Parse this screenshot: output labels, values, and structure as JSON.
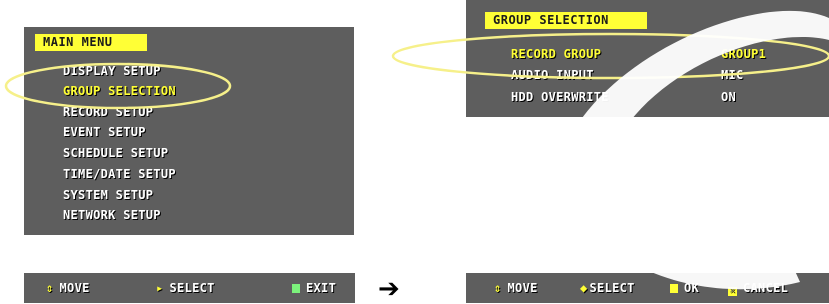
{
  "main_menu": {
    "title": "MAIN MENU",
    "items": [
      {
        "label": "DISPLAY SETUP",
        "selected": false
      },
      {
        "label": "GROUP SELECTION",
        "selected": true
      },
      {
        "label": "RECORD SETUP",
        "selected": false
      },
      {
        "label": "EVENT SETUP",
        "selected": false
      },
      {
        "label": "SCHEDULE SETUP",
        "selected": false
      },
      {
        "label": "TIME/DATE SETUP",
        "selected": false
      },
      {
        "label": "SYSTEM SETUP",
        "selected": false
      },
      {
        "label": "NETWORK SETUP",
        "selected": false
      }
    ],
    "footer": {
      "move": "MOVE",
      "select": "SELECT",
      "exit": "EXIT"
    }
  },
  "group_selection": {
    "title": "GROUP SELECTION",
    "rows": [
      {
        "label": "RECORD GROUP",
        "value": "GROUP1",
        "selected": true
      },
      {
        "label": "AUDIO INPUT",
        "value": "MIC",
        "selected": false
      },
      {
        "label": "HDD OVERWRITE",
        "value": "ON",
        "selected": false
      }
    ],
    "footer": {
      "move": "MOVE",
      "select": "SELECT",
      "ok": "OK",
      "cancel": "CANCEL"
    }
  },
  "icons": {
    "move": "up-down-arrows-icon",
    "select_main": "right-triangle-icon",
    "exit": "green-square-icon",
    "select_group": "left-right-diamond-icon",
    "ok": "yellow-square-icon",
    "cancel": "x-box-icon",
    "transition": "right-arrow-icon"
  },
  "colors": {
    "panel": "#5e5e5e",
    "title_bg": "#ffff36",
    "selected_text": "#ffff36",
    "text": "#ffffff",
    "highlight_ellipse": "#f6f08a"
  }
}
